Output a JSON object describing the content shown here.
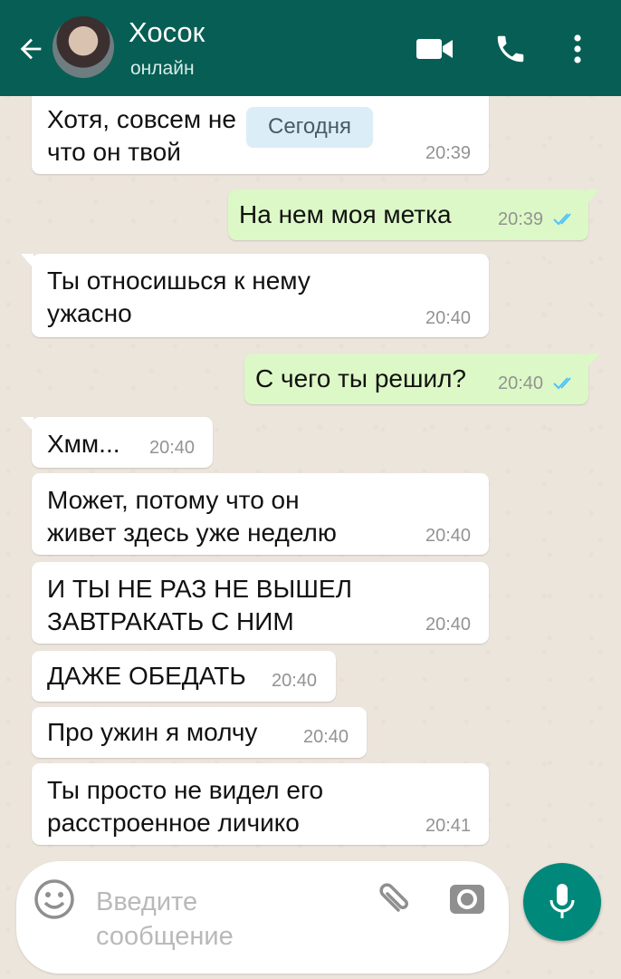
{
  "header": {
    "contact_name": "Хосок",
    "status": "онлайн",
    "background_color": "#075e54"
  },
  "date_chip": "Сегодня",
  "messages": [
    {
      "direction": "in",
      "lines": [
        "Хотя, совсем не",
        "что он твой"
      ],
      "time": "20:39"
    },
    {
      "direction": "out",
      "lines": [
        "На нем моя метка"
      ],
      "time": "20:39",
      "read": true
    },
    {
      "direction": "in",
      "lines": [
        "Ты относишься к нему",
        "ужасно"
      ],
      "time": "20:40"
    },
    {
      "direction": "out",
      "lines": [
        "С чего ты решил?"
      ],
      "time": "20:40",
      "read": true
    },
    {
      "direction": "in",
      "lines": [
        "Хмм..."
      ],
      "time": "20:40"
    },
    {
      "direction": "in",
      "lines": [
        "Может, потому что он",
        "живет здесь уже неделю"
      ],
      "time": "20:40"
    },
    {
      "direction": "in",
      "lines": [
        "И ТЫ НЕ РАЗ НЕ ВЫШЕЛ",
        "ЗАВТРАКАТЬ С НИМ"
      ],
      "time": "20:40"
    },
    {
      "direction": "in",
      "lines": [
        "ДАЖЕ ОБЕДАТЬ"
      ],
      "time": "20:40"
    },
    {
      "direction": "in",
      "lines": [
        "Про ужин я молчу"
      ],
      "time": "20:40"
    },
    {
      "direction": "in",
      "lines": [
        "Ты просто не видел его",
        "расстроенное личико"
      ],
      "time": "20:41"
    }
  ],
  "input": {
    "placeholder_line1": "Введите",
    "placeholder_line2": "сообщение"
  },
  "icons": {
    "back": "arrow-back-icon",
    "video": "video-call-icon",
    "call": "phone-icon",
    "menu": "more-vert-icon",
    "emoji": "emoji-icon",
    "attach": "paperclip-icon",
    "camera": "camera-icon",
    "mic": "mic-icon"
  },
  "colors": {
    "incoming_bubble": "#ffffff",
    "outgoing_bubble": "#dcf8c6",
    "read_ticks": "#4fc3f7",
    "mic_button": "#00897b"
  }
}
